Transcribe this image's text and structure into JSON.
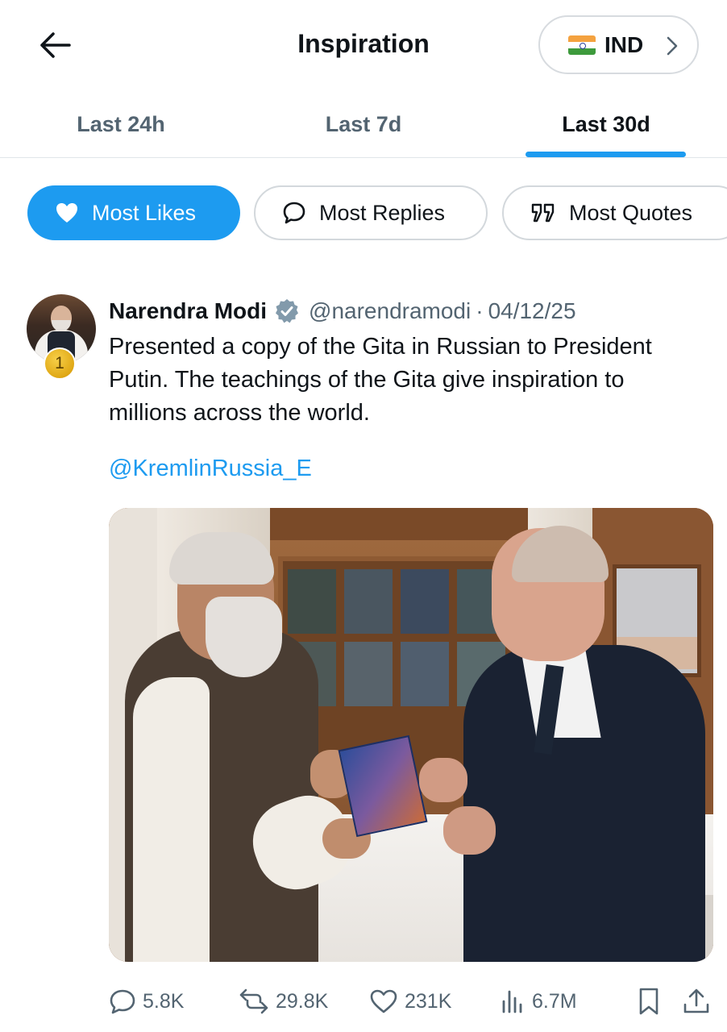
{
  "header": {
    "back_icon": "arrow-left-icon",
    "title": "Inspiration",
    "country": {
      "flag_icon": "india-flag-icon",
      "label": "IND",
      "chevron_icon": "chevron-right-icon"
    }
  },
  "tabs": [
    {
      "label": "Last 24h",
      "active": false
    },
    {
      "label": "Last 7d",
      "active": false
    },
    {
      "label": "Last 30d",
      "active": true
    }
  ],
  "filters": [
    {
      "label": "Most Likes",
      "icon": "heart-icon",
      "active": true
    },
    {
      "label": "Most Replies",
      "icon": "speech-bubble-icon",
      "active": false
    },
    {
      "label": "Most Quotes",
      "icon": "quote-icon",
      "active": false
    }
  ],
  "post": {
    "rank": "1",
    "author": "Narendra Modi",
    "verified": true,
    "handle": "@narendramodi",
    "separator": "·",
    "date": "04/12/25",
    "text": "Presented a copy of the Gita in Russian to President Putin. The teachings of the Gita give inspiration to millions across the world.",
    "mention": "@KremlinRussia_E",
    "stats": {
      "replies": "5.8K",
      "reposts": "29.8K",
      "likes": "231K",
      "views": "6.7M"
    }
  },
  "colors": {
    "accent": "#1d9bf0",
    "text_primary": "#0f1419",
    "text_secondary": "#536471",
    "border": "#d3d8dc"
  }
}
